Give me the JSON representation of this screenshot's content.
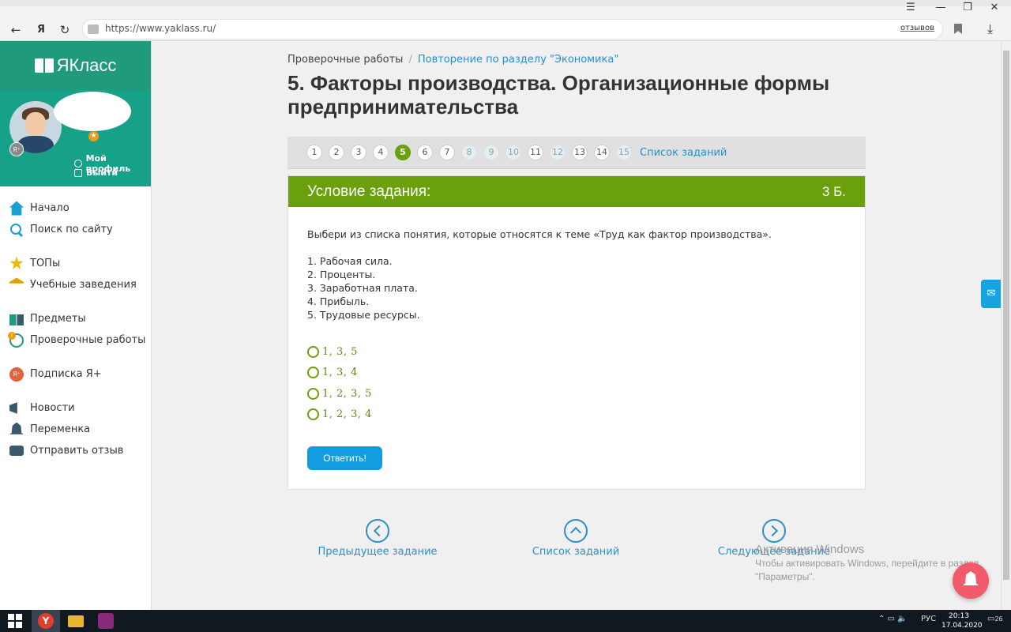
{
  "browser": {
    "url": "https://www.yaklass.ru/",
    "reviews": "отзывов"
  },
  "sidebar": {
    "logo": "ЯКласс",
    "profile": {
      "my_profile": "Мой профиль",
      "logout": "Выйти"
    },
    "items": [
      {
        "label": "Начало",
        "icon": "home-icon"
      },
      {
        "label": "Поиск по сайту",
        "icon": "search-icon"
      },
      {
        "label": "ТОПы",
        "icon": "star-icon"
      },
      {
        "label": "Учебные заведения",
        "icon": "school-icon"
      },
      {
        "label": "Предметы",
        "icon": "book-icon"
      },
      {
        "label": "Проверочные работы",
        "icon": "check-icon"
      },
      {
        "label": "Подписка Я+",
        "icon": "ya-plus-icon"
      },
      {
        "label": "Новости",
        "icon": "megaphone-icon"
      },
      {
        "label": "Переменка",
        "icon": "bell-icon"
      },
      {
        "label": "Отправить отзыв",
        "icon": "message-icon"
      }
    ]
  },
  "breadcrumb": {
    "first": "Проверочные работы",
    "separator": "/",
    "second": "Повторение по разделу \"Экономика\""
  },
  "title": "5. Факторы производства. Организационные формы предпринимательства",
  "pager": {
    "pages": [
      "1",
      "2",
      "3",
      "4",
      "5",
      "6",
      "7",
      "8",
      "9",
      "10",
      "11",
      "12",
      "13",
      "14",
      "15"
    ],
    "active": "5",
    "list_link": "Список заданий"
  },
  "task": {
    "header": "Условие задания:",
    "points": "3 Б.",
    "question": "Выбери из списка понятия, которые относятся к теме «Труд как фактор производства».",
    "items": [
      "1. Рабочая сила.",
      "2. Проценты.",
      "3. Заработная плата.",
      "4. Прибыль.",
      "5. Трудовые ресурсы."
    ],
    "options": [
      "1, 3, 5",
      "1, 3, 4",
      "1, 2, 3, 5",
      "1, 2, 3, 4"
    ],
    "answer_button": "Ответить!"
  },
  "bottom_nav": {
    "prev": "Предыдущее задание",
    "list": "Список заданий",
    "next": "Следующее задание"
  },
  "watermark": {
    "line1": "Активация Windows",
    "line2": "Чтобы активировать Windows, перейдите в раздел",
    "line3": "\"Параметры\"."
  },
  "taskbar": {
    "lang": "РУС",
    "time": "20:13",
    "date": "17.04.2020",
    "notifications": "26"
  },
  "colors": {
    "brand_green": "#1f9a7a",
    "task_green": "#6aa00b",
    "link_blue": "#2a8fc9",
    "button_blue": "#139de0"
  }
}
